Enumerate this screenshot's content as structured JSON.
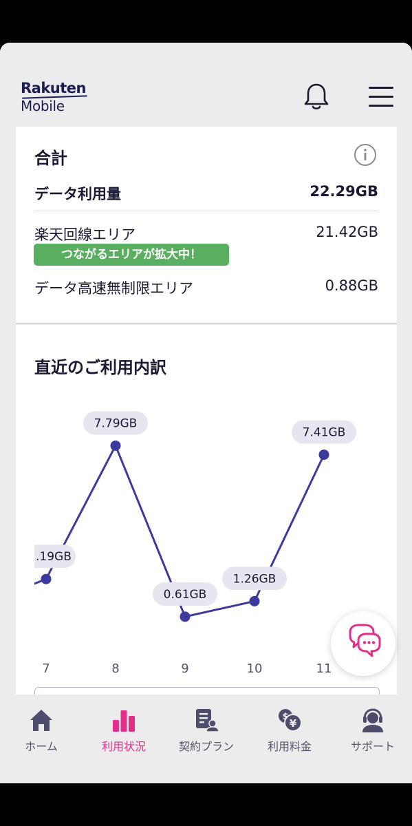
{
  "header": {
    "logo_top": "Rakuten",
    "logo_bottom": "Mobile",
    "icons": [
      "bell-icon",
      "hamburger-menu-icon"
    ]
  },
  "summary": {
    "title": "合計",
    "data_usage_label": "データ利用量",
    "data_usage_value": "22.29GB",
    "rakuten_area_label": "楽天回線エリア",
    "rakuten_area_value": "21.42GB",
    "badge": "つながるエリアが拡大中！",
    "unlimited_area_label": "データ高速無制限エリア",
    "unlimited_area_value": "0.88GB"
  },
  "recent": {
    "title": "直近のご利用内訳"
  },
  "chart_data": {
    "type": "line",
    "x": [
      "7",
      "8",
      "9",
      "10",
      "11"
    ],
    "values": [
      2.19,
      7.79,
      0.61,
      1.26,
      7.41
    ],
    "labels": [
      ".19GB",
      "7.79GB",
      "0.61GB",
      "1.26GB",
      "7.41GB"
    ],
    "color": "#3d3a9e"
  },
  "nav": {
    "items": [
      {
        "label": "ホーム",
        "icon": "home-icon"
      },
      {
        "label": "利用状況",
        "icon": "bar-chart-icon"
      },
      {
        "label": "契約プラン",
        "icon": "contract-icon"
      },
      {
        "label": "利用料金",
        "icon": "yen-coins-icon"
      },
      {
        "label": "サポート",
        "icon": "support-agent-icon"
      }
    ],
    "active_color": "#e2308a",
    "inactive_color": "#55566b"
  }
}
